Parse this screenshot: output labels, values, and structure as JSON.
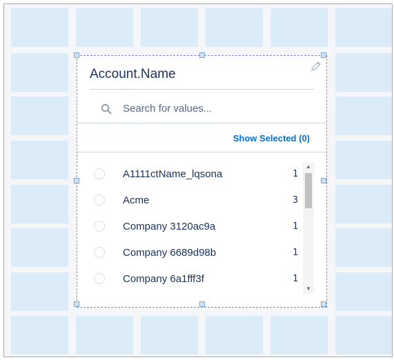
{
  "widget": {
    "title": "Account.Name",
    "search_placeholder": "Search for values...",
    "show_selected_label": "Show Selected (0)",
    "items": [
      {
        "label": "A1111ctName_lqsona",
        "count": "1"
      },
      {
        "label": "Acme",
        "count": "3"
      },
      {
        "label": "Company 3120ac9a",
        "count": "1"
      },
      {
        "label": "Company 6689d98b",
        "count": "1"
      },
      {
        "label": "Company 6a1fff3f",
        "count": "1"
      }
    ]
  },
  "icons": {
    "search": "search-icon",
    "edit": "pencil-icon",
    "scroll_up": "triangle-up-icon",
    "scroll_down": "triangle-down-icon"
  },
  "colors": {
    "grid_cell": "#dbebf7",
    "grid_background": "#f4f6f9",
    "link_blue": "#0070d2",
    "text_dark": "#16325c",
    "selection_outline": "#8a82c8"
  }
}
